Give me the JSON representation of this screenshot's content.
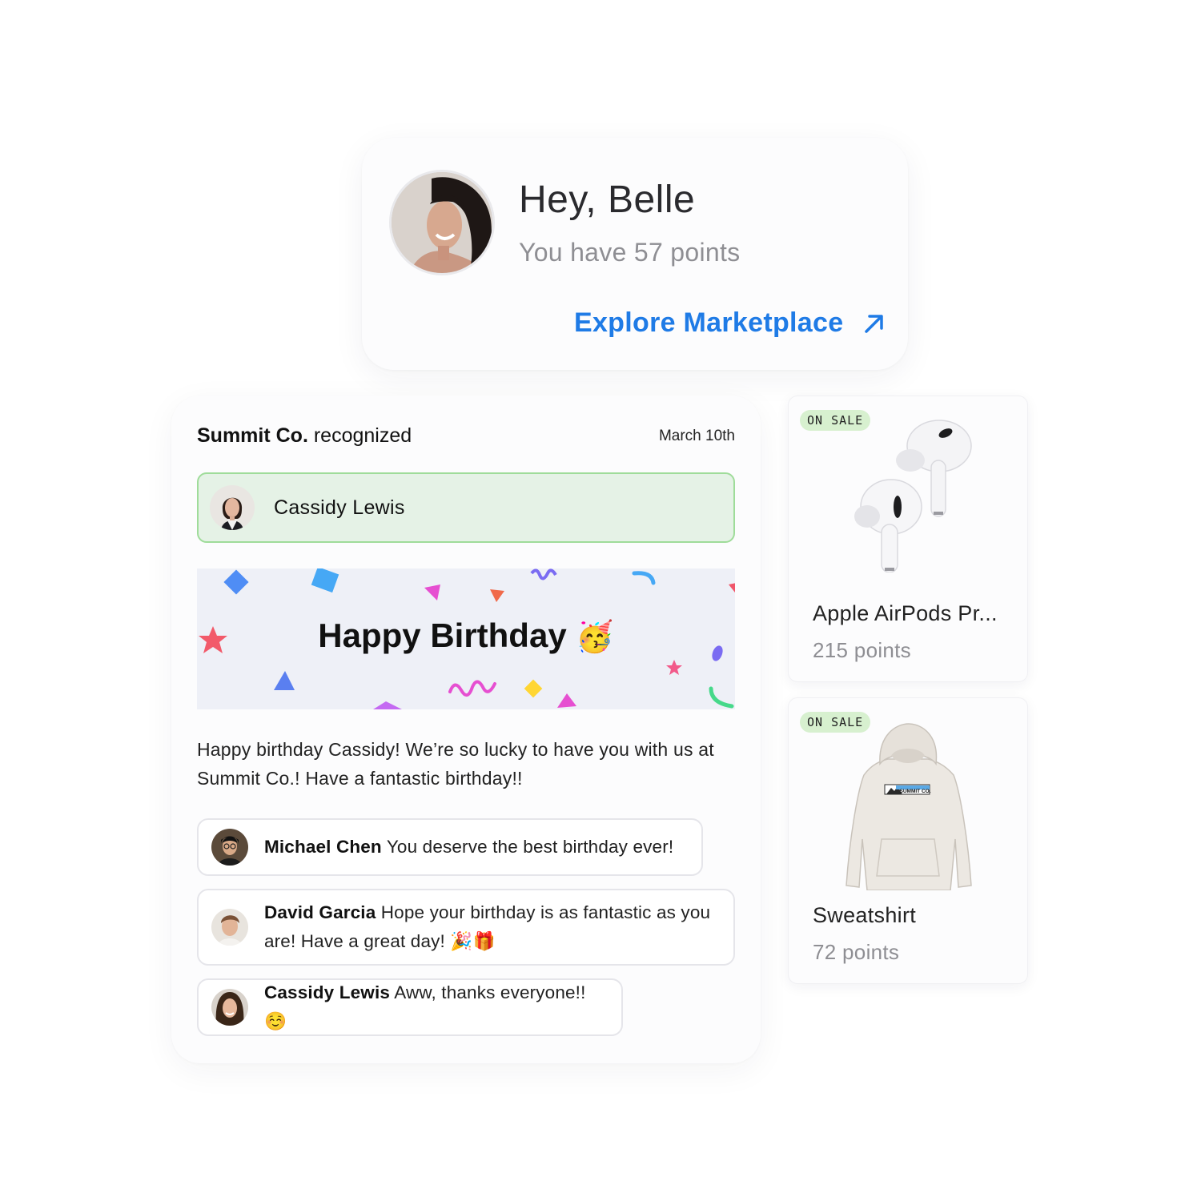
{
  "greeting": {
    "title": "Hey, Belle",
    "subtitle": "You have 57 points",
    "explore_label": "Explore Marketplace"
  },
  "feed": {
    "org": "Summit Co.",
    "action": "recognized",
    "date": "March 10th",
    "recipient": "Cassidy Lewis",
    "banner_title": "Happy Birthday",
    "banner_emoji": "🥳",
    "message": "Happy birthday Cassidy! We’re so lucky to have you with us at Summit Co.! Have a fantastic birthday!!",
    "comments": [
      {
        "author": "Michael Chen",
        "text": "You deserve the best birthday ever!"
      },
      {
        "author": "David Garcia",
        "text": "Hope your birthday is as fantastic as you are! Have a great day! 🎉🎁"
      },
      {
        "author": "Cassidy Lewis",
        "text": "Aww, thanks everyone!! ☺️"
      }
    ]
  },
  "products": [
    {
      "badge": "ON SALE",
      "name": "Apple AirPods Pr...",
      "points": "215 points"
    },
    {
      "badge": "ON SALE",
      "name": "Sweatshirt",
      "points": "72 points",
      "logo_text": "SUMMIT CO."
    }
  ],
  "colors": {
    "accent": "#1f7be6",
    "recipient_bg": "#e5f2e6",
    "recipient_border": "#9fdc9a",
    "sale_badge_bg": "#d7f0cf",
    "banner_bg": "#eef0f7"
  }
}
